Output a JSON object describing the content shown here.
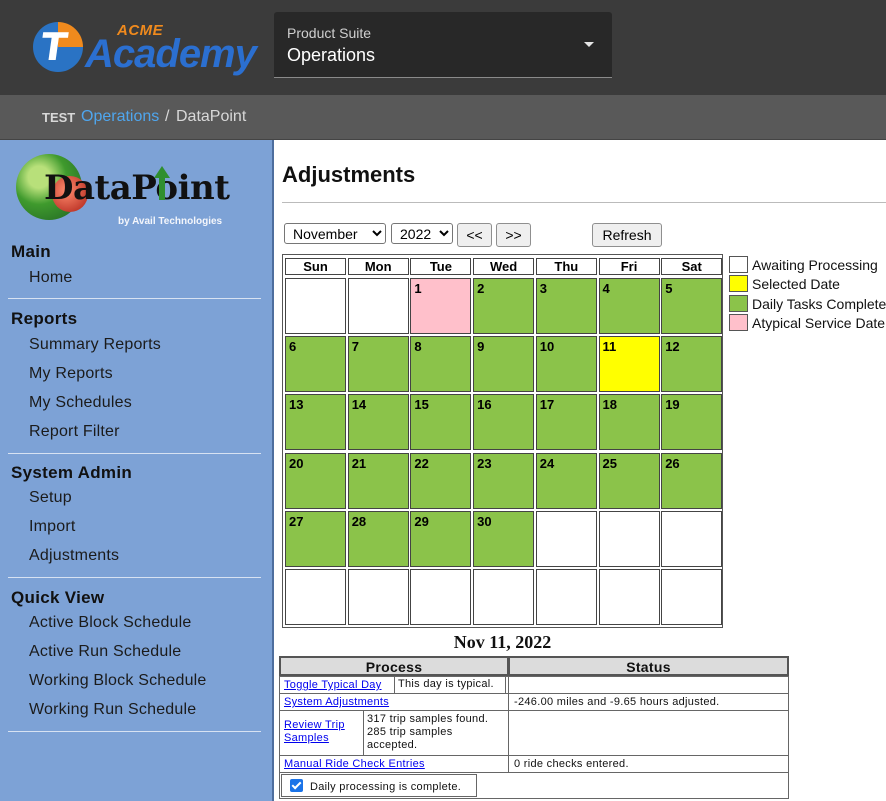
{
  "brand": {
    "acme": "ACME",
    "academy": "Academy",
    "logo_letter": "T"
  },
  "suite": {
    "label": "Product Suite",
    "value": "Operations"
  },
  "breadcrumb": {
    "env": "TEST",
    "ops": "Operations",
    "sep": "/",
    "current": "DataPoint"
  },
  "sidebar_logo": {
    "word": "DataPoint",
    "byline": "by Avail Technologies"
  },
  "sidebar": {
    "main": {
      "title": "Main",
      "items": [
        "Home"
      ]
    },
    "reports": {
      "title": "Reports",
      "items": [
        "Summary Reports",
        "My Reports",
        "My Schedules",
        "Report Filter"
      ]
    },
    "admin": {
      "title": "System Admin",
      "items": [
        "Setup",
        "Import",
        "Adjustments"
      ]
    },
    "quick": {
      "title": "Quick View",
      "items": [
        "Active Block Schedule",
        "Active Run Schedule",
        "Working Block Schedule",
        "Working Run Schedule"
      ]
    }
  },
  "page": {
    "title": "Adjustments"
  },
  "controls": {
    "month": "November",
    "year": "2022",
    "prev": "<<",
    "next": ">>",
    "refresh": "Refresh"
  },
  "colors": {
    "green": "#8bc34a",
    "yellow": "#ffff00",
    "pink": "#ffc0cb",
    "white": "#ffffff"
  },
  "calendar": {
    "weekdays": [
      "Sun",
      "Mon",
      "Tue",
      "Wed",
      "Thu",
      "Fri",
      "Sat"
    ],
    "weeks": [
      [
        [
          "",
          "white"
        ],
        [
          "",
          "white"
        ],
        [
          "1",
          "pink"
        ],
        [
          "2",
          "green"
        ],
        [
          "3",
          "green"
        ],
        [
          "4",
          "green"
        ],
        [
          "5",
          "green"
        ]
      ],
      [
        [
          "6",
          "green"
        ],
        [
          "7",
          "green"
        ],
        [
          "8",
          "green"
        ],
        [
          "9",
          "green"
        ],
        [
          "10",
          "green"
        ],
        [
          "11",
          "yellow"
        ],
        [
          "12",
          "green"
        ]
      ],
      [
        [
          "13",
          "green"
        ],
        [
          "14",
          "green"
        ],
        [
          "15",
          "green"
        ],
        [
          "16",
          "green"
        ],
        [
          "17",
          "green"
        ],
        [
          "18",
          "green"
        ],
        [
          "19",
          "green"
        ]
      ],
      [
        [
          "20",
          "green"
        ],
        [
          "21",
          "green"
        ],
        [
          "22",
          "green"
        ],
        [
          "23",
          "green"
        ],
        [
          "24",
          "green"
        ],
        [
          "25",
          "green"
        ],
        [
          "26",
          "green"
        ]
      ],
      [
        [
          "27",
          "green"
        ],
        [
          "28",
          "green"
        ],
        [
          "29",
          "green"
        ],
        [
          "30",
          "green"
        ],
        [
          "",
          "white"
        ],
        [
          "",
          "white"
        ],
        [
          "",
          "white"
        ]
      ],
      [
        [
          "",
          "white"
        ],
        [
          "",
          "white"
        ],
        [
          "",
          "white"
        ],
        [
          "",
          "white"
        ],
        [
          "",
          "white"
        ],
        [
          "",
          "white"
        ],
        [
          "",
          "white"
        ]
      ]
    ]
  },
  "legend": [
    {
      "label": "Awaiting Processing",
      "color": "white"
    },
    {
      "label": "Selected Date",
      "color": "yellow"
    },
    {
      "label": "Daily Tasks Complete",
      "color": "green"
    },
    {
      "label": "Atypical Service Date",
      "color": "pink"
    }
  ],
  "selected_date": "Nov 11, 2022",
  "process_table": {
    "headers": [
      "Process",
      "Status"
    ],
    "toggle": {
      "link": "Toggle Typical Day",
      "note": "This day is typical."
    },
    "adjust": {
      "link": "System Adjustments",
      "status": "-246.00 miles and -9.65 hours adjusted."
    },
    "review": {
      "link": "Review Trip Samples",
      "note": "317 trip samples found. 285 trip samples accepted."
    },
    "manual": {
      "link": "Manual Ride Check Entries",
      "status": "0 ride checks entered."
    },
    "complete": {
      "label": "Daily processing is complete.",
      "checked": true
    }
  }
}
